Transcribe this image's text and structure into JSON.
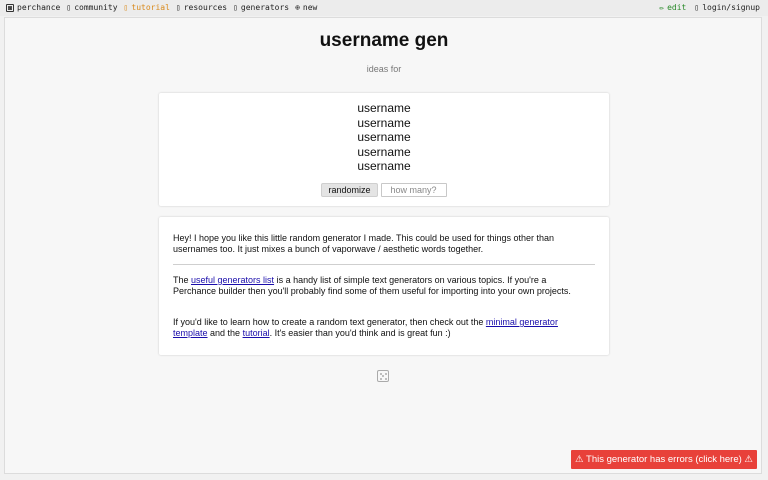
{
  "nav": {
    "brand": "perchance",
    "community": "community",
    "tutorial": "tutorial",
    "resources": "resources",
    "generators": "generators",
    "new": "new",
    "edit": "edit",
    "login": "login/signup",
    "icons": {
      "community": "chat-icon",
      "tutorial": "book-icon",
      "resources": "toolbox-icon",
      "generators": "list-icon",
      "new": "plus-circle-icon",
      "edit": "pencil-icon",
      "login": "user-icon"
    },
    "colors": {
      "tutorial": "#d98a1c",
      "edit": "#2a8a2a"
    }
  },
  "page": {
    "title": "username gen",
    "subtitle": "ideas for"
  },
  "generator": {
    "outputs": [
      "username",
      "username",
      "username",
      "username",
      "username"
    ],
    "randomize_label": "randomize",
    "howmany_placeholder": "how many?"
  },
  "info": {
    "p1": "Hey! I hope you like this little random generator I made. This could be used for things other than usernames too. It just mixes a bunch of vaporwave / aesthetic words together.",
    "p2_before": "The ",
    "p2_link": "useful generators list",
    "p2_after": " is a handy list of simple text generators on various topics. If you're a Perchance builder then you'll probably find some of them useful for importing into your own projects.",
    "p3_before": "If you'd like to learn how to create a random text generator, then check out the ",
    "p3_link1": "minimal generator template",
    "p3_mid": " and the ",
    "p3_link2": "tutorial",
    "p3_after": ". It's easier than you'd think and is great fun :)"
  },
  "error": {
    "text": "⚠ This generator has errors (click here) ⚠",
    "color": "#e8413a"
  }
}
